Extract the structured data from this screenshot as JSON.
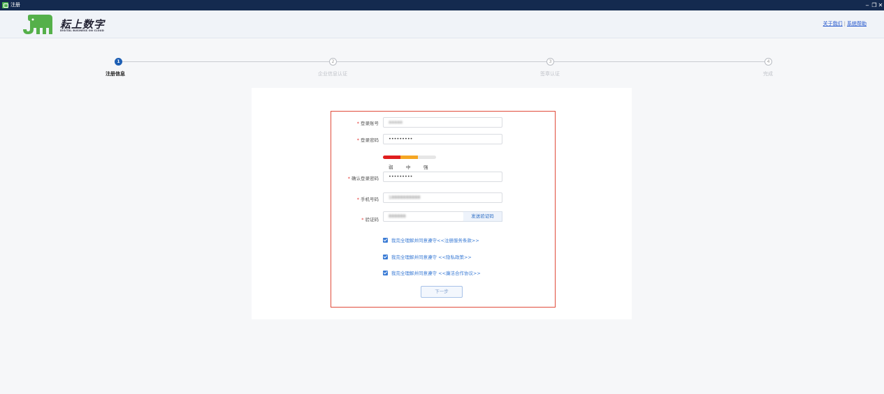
{
  "window": {
    "title": "注册",
    "minimize": "‒",
    "maximize": "❐",
    "close": "✕"
  },
  "header": {
    "brand": "耘上数字",
    "brand_sub": "DIGITAL BUSINESS ON CLOUD",
    "links": [
      "关于我们",
      "系统帮助"
    ],
    "link_separator": "|",
    "logo_color": "#4caf50"
  },
  "stepper": {
    "steps": [
      {
        "num": "1",
        "label": "注册信息",
        "active": true
      },
      {
        "num": "2",
        "label": "企业信息认证",
        "active": false
      },
      {
        "num": "3",
        "label": "签章认证",
        "active": false
      },
      {
        "num": "4",
        "label": "完成",
        "active": false
      }
    ]
  },
  "form": {
    "required_mark": "*",
    "account": {
      "label": "登录账号",
      "value": "aaaaa"
    },
    "password": {
      "label": "登录密码",
      "value": "•••••••••"
    },
    "strength": {
      "levels": [
        "弱",
        "中",
        "强"
      ],
      "level": 2
    },
    "confirm_password": {
      "label": "确认登录密码",
      "value": "•••••••••"
    },
    "phone": {
      "label": "手机号码",
      "value": "18888888888"
    },
    "code": {
      "label": "验证码",
      "value": "888888",
      "send_label": "发送验证码"
    },
    "agreements": [
      "我完全理解并同意遵守<<注册服务条款>>",
      "我完全理解并同意遵守 <<隐私政策>>",
      "我完全理解并同意遵守 <<廉洁合作协议>>"
    ],
    "next_label": "下一步"
  },
  "colors": {
    "primary": "#1e5fb4",
    "highlight_border": "#e04b3a",
    "link": "#2255cc"
  }
}
